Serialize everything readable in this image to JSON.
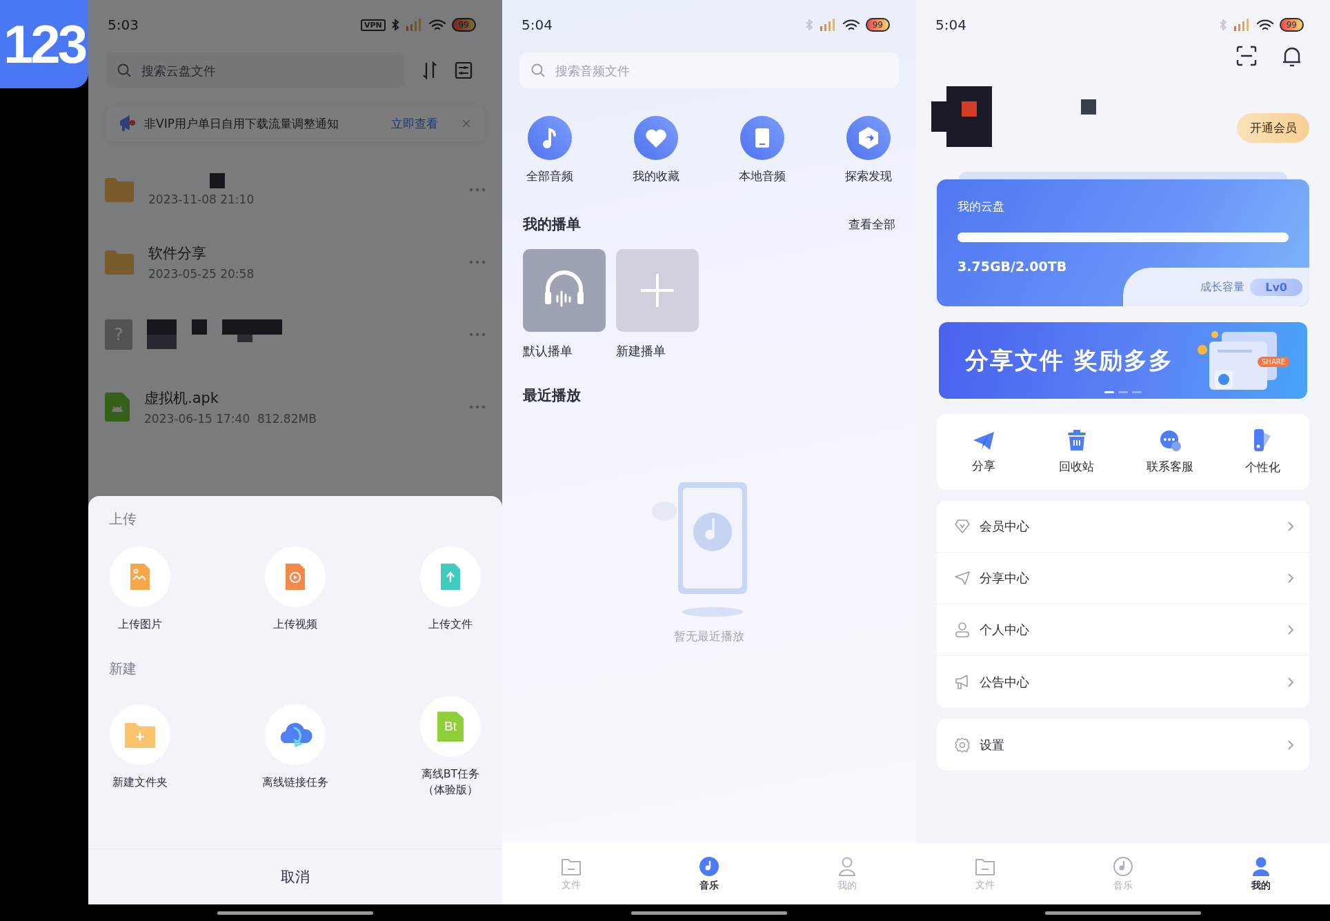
{
  "logo": {
    "text": "123"
  },
  "files_screen": {
    "status_bar": {
      "time": "5:03",
      "vpn": "VPN",
      "battery": "99"
    },
    "search": {
      "placeholder": "搜索云盘文件"
    },
    "notice": {
      "text": "非VIP用户单日自用下载流量调整通知",
      "link": "立即查看"
    },
    "files": [
      {
        "kind": "folder",
        "name_redacted": true,
        "meta_redacted": false,
        "meta": "2023-11-08 21:10"
      },
      {
        "kind": "folder",
        "name": "软件分享",
        "meta": "2023-05-25 20:58"
      },
      {
        "kind": "unknown",
        "icon_text": "?",
        "name_redacted": true,
        "meta_redacted": true
      },
      {
        "kind": "apk",
        "name": "虚拟机.apk",
        "meta": "2023-06-15 17:40  812.82MB"
      }
    ],
    "sheet": {
      "sections": [
        {
          "title": "上传",
          "actions": [
            {
              "kind": "image",
              "label": "上传图片"
            },
            {
              "kind": "video",
              "label": "上传视频"
            },
            {
              "kind": "file",
              "label": "上传文件"
            }
          ]
        },
        {
          "title": "新建",
          "actions": [
            {
              "kind": "folder",
              "label": "新建文件夹"
            },
            {
              "kind": "cloud",
              "label": "离线链接任务"
            },
            {
              "kind": "bt",
              "icon_text": "Bt",
              "label": "离线BT任务",
              "note": "（体验版）"
            }
          ]
        }
      ],
      "cancel": "取消"
    }
  },
  "music_screen": {
    "status_bar": {
      "time": "5:04",
      "battery": "99"
    },
    "search": {
      "placeholder": "搜索音频文件"
    },
    "shortcuts": [
      {
        "kind": "note",
        "label": "全部音频"
      },
      {
        "kind": "heart",
        "label": "我的收藏"
      },
      {
        "kind": "device",
        "label": "本地音频"
      },
      {
        "kind": "explore",
        "label": "探索发现"
      }
    ],
    "playlists": {
      "title": "我的播单",
      "more": "查看全部",
      "items": [
        {
          "kind": "default",
          "label": "默认播单"
        },
        {
          "kind": "new",
          "label": "新建播单"
        }
      ]
    },
    "recent": {
      "title": "最近播放",
      "empty": "暂无最近播放"
    },
    "tabs": [
      {
        "kind": "files",
        "label": "文件",
        "selected": false
      },
      {
        "kind": "music",
        "label": "音乐",
        "selected": true
      },
      {
        "kind": "me",
        "label": "我的",
        "selected": false
      }
    ]
  },
  "profile_screen": {
    "status_bar": {
      "time": "5:04",
      "battery": "99"
    },
    "vip_button": "开通会员",
    "storage": {
      "title": "我的云盘",
      "level": 0.002,
      "usage": "3.75GB/2.00TB",
      "growth_label": "成长容量",
      "growth_level": "Lv0"
    },
    "banner": {
      "text": "分享文件 奖励多多",
      "tag": "SHARE",
      "pages": [
        {
          "selected": true
        },
        {
          "selected": false
        },
        {
          "selected": false
        }
      ]
    },
    "actions": [
      {
        "kind": "share",
        "label": "分享"
      },
      {
        "kind": "trash",
        "label": "回收站"
      },
      {
        "kind": "support",
        "label": "联系客服"
      },
      {
        "kind": "theme",
        "label": "个性化"
      }
    ],
    "menu": [
      {
        "kind": "vip",
        "label": "会员中心"
      },
      {
        "kind": "share",
        "label": "分享中心"
      },
      {
        "kind": "person",
        "label": "个人中心"
      },
      {
        "kind": "announce",
        "label": "公告中心"
      }
    ],
    "settings": {
      "kind": "gear",
      "label": "设置"
    },
    "tabs": [
      {
        "kind": "files",
        "label": "文件",
        "selected": false
      },
      {
        "kind": "music",
        "label": "音乐",
        "selected": false
      },
      {
        "kind": "me",
        "label": "我的",
        "selected": true
      }
    ]
  }
}
